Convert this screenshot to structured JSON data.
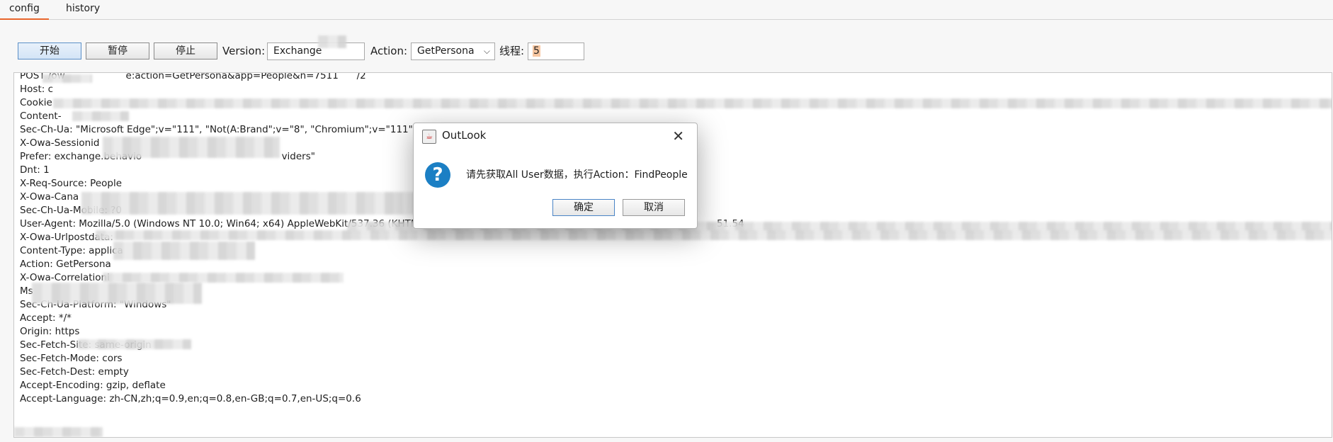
{
  "tabs": [
    {
      "label": "config"
    },
    {
      "label": "history"
    }
  ],
  "toolbar": {
    "start_label": "开始",
    "pause_label": "暂停",
    "stop_label": "停止",
    "version_label": "Version:",
    "version_value": "Exchange",
    "action_label": "Action:",
    "action_value": "GetPersona",
    "threads_label": "线程:",
    "threads_value": "5"
  },
  "request_lines": [
    "POST /ow                    e:action=GetPersona&app=People&n=7511      /2",
    "Host: c",
    "Cookie",
    "Content-",
    "Sec-Ch-Ua: \"Microsoft Edge\";v=\"111\", \"Not(A:Brand\";v=\"8\", \"Chromium\";v=\"111\"",
    "X-Owa-Sessionid",
    "Prefer: exchange.behavio                                              viders\"",
    "Dnt: 1",
    "X-Req-Source: People",
    "X-Owa-Cana",
    "Sec-Ch-Ua-Mobile: ?0",
    "User-Agent: Mozilla/5.0 (Windows NT 10.0; Win64; x64) AppleWebKit/537.36 (KHTM",
    "X-Owa-Urlpostdata:",
    "Content-Type: applica",
    "Action: GetPersona",
    "X-Owa-Correlationi",
    "Ms",
    "Sec-Ch-Ua-Platform: \"Windows\"",
    "Accept: */*",
    "Origin: https",
    "Sec-Fetch-Site: same-origin",
    "Sec-Fetch-Mode: cors",
    "Sec-Fetch-Dest: empty",
    "Accept-Encoding: gzip, deflate",
    "Accept-Language: zh-CN,zh;q=0.9,en;q=0.8,en-GB;q=0.7,en-US;q=0.6"
  ],
  "ua_suffix": "51.54",
  "dialog": {
    "title": "OutLook",
    "message": "请先获取All User数据，执行Action：FindPeople",
    "ok_label": "确定",
    "cancel_label": "取消"
  }
}
